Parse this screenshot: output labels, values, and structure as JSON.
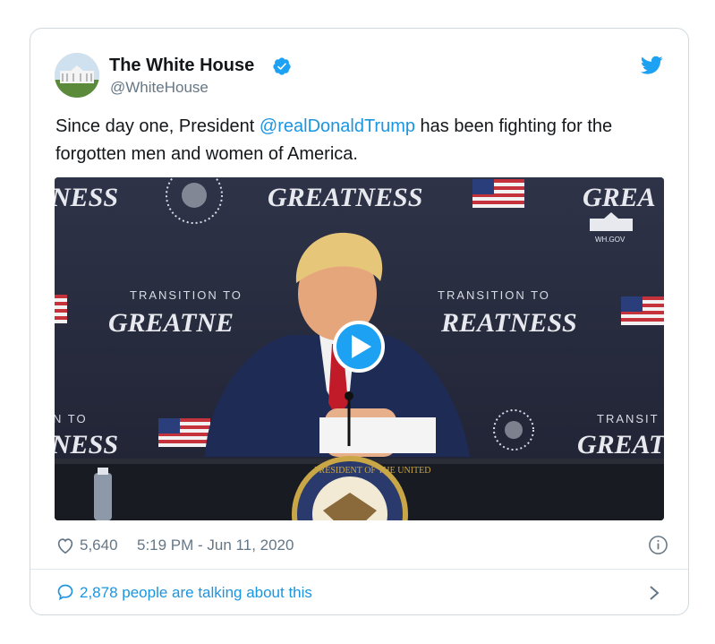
{
  "tweet": {
    "display_name": "The White House",
    "handle": "@WhiteHouse",
    "text_before": "Since day one, President ",
    "mention": "@realDonaldTrump",
    "text_after": " has been fighting for the forgotten men and women of America.",
    "likes": "5,640",
    "timestamp": "5:19 PM - Jun 11, 2020",
    "conversation": "2,878 people are talking about this"
  },
  "media": {
    "backdrop_words": {
      "greatness_full": "GREATNESS",
      "greatness_partial_1": "GREATNE",
      "greatness_partial_2": "REATNESS",
      "greatness_left": "NESS",
      "greatness_right": "GREA",
      "greatness_right_2": "GREAT",
      "transition_to": "TRANSITION TO",
      "n_to": "N TO",
      "transit": "TRANSIT",
      "wh_gov": "WH.GOV",
      "seal_text": "PRESIDENT OF THE UNITED"
    }
  },
  "colors": {
    "link": "#1b95e0",
    "muted": "#657786",
    "text": "#14171a",
    "verified": "#1da1f2"
  },
  "icons": [
    "avatar-white-house",
    "verified-badge-icon",
    "twitter-bird-icon",
    "play-icon",
    "heart-icon",
    "info-icon",
    "speech-bubble-icon",
    "chevron-right-icon"
  ]
}
